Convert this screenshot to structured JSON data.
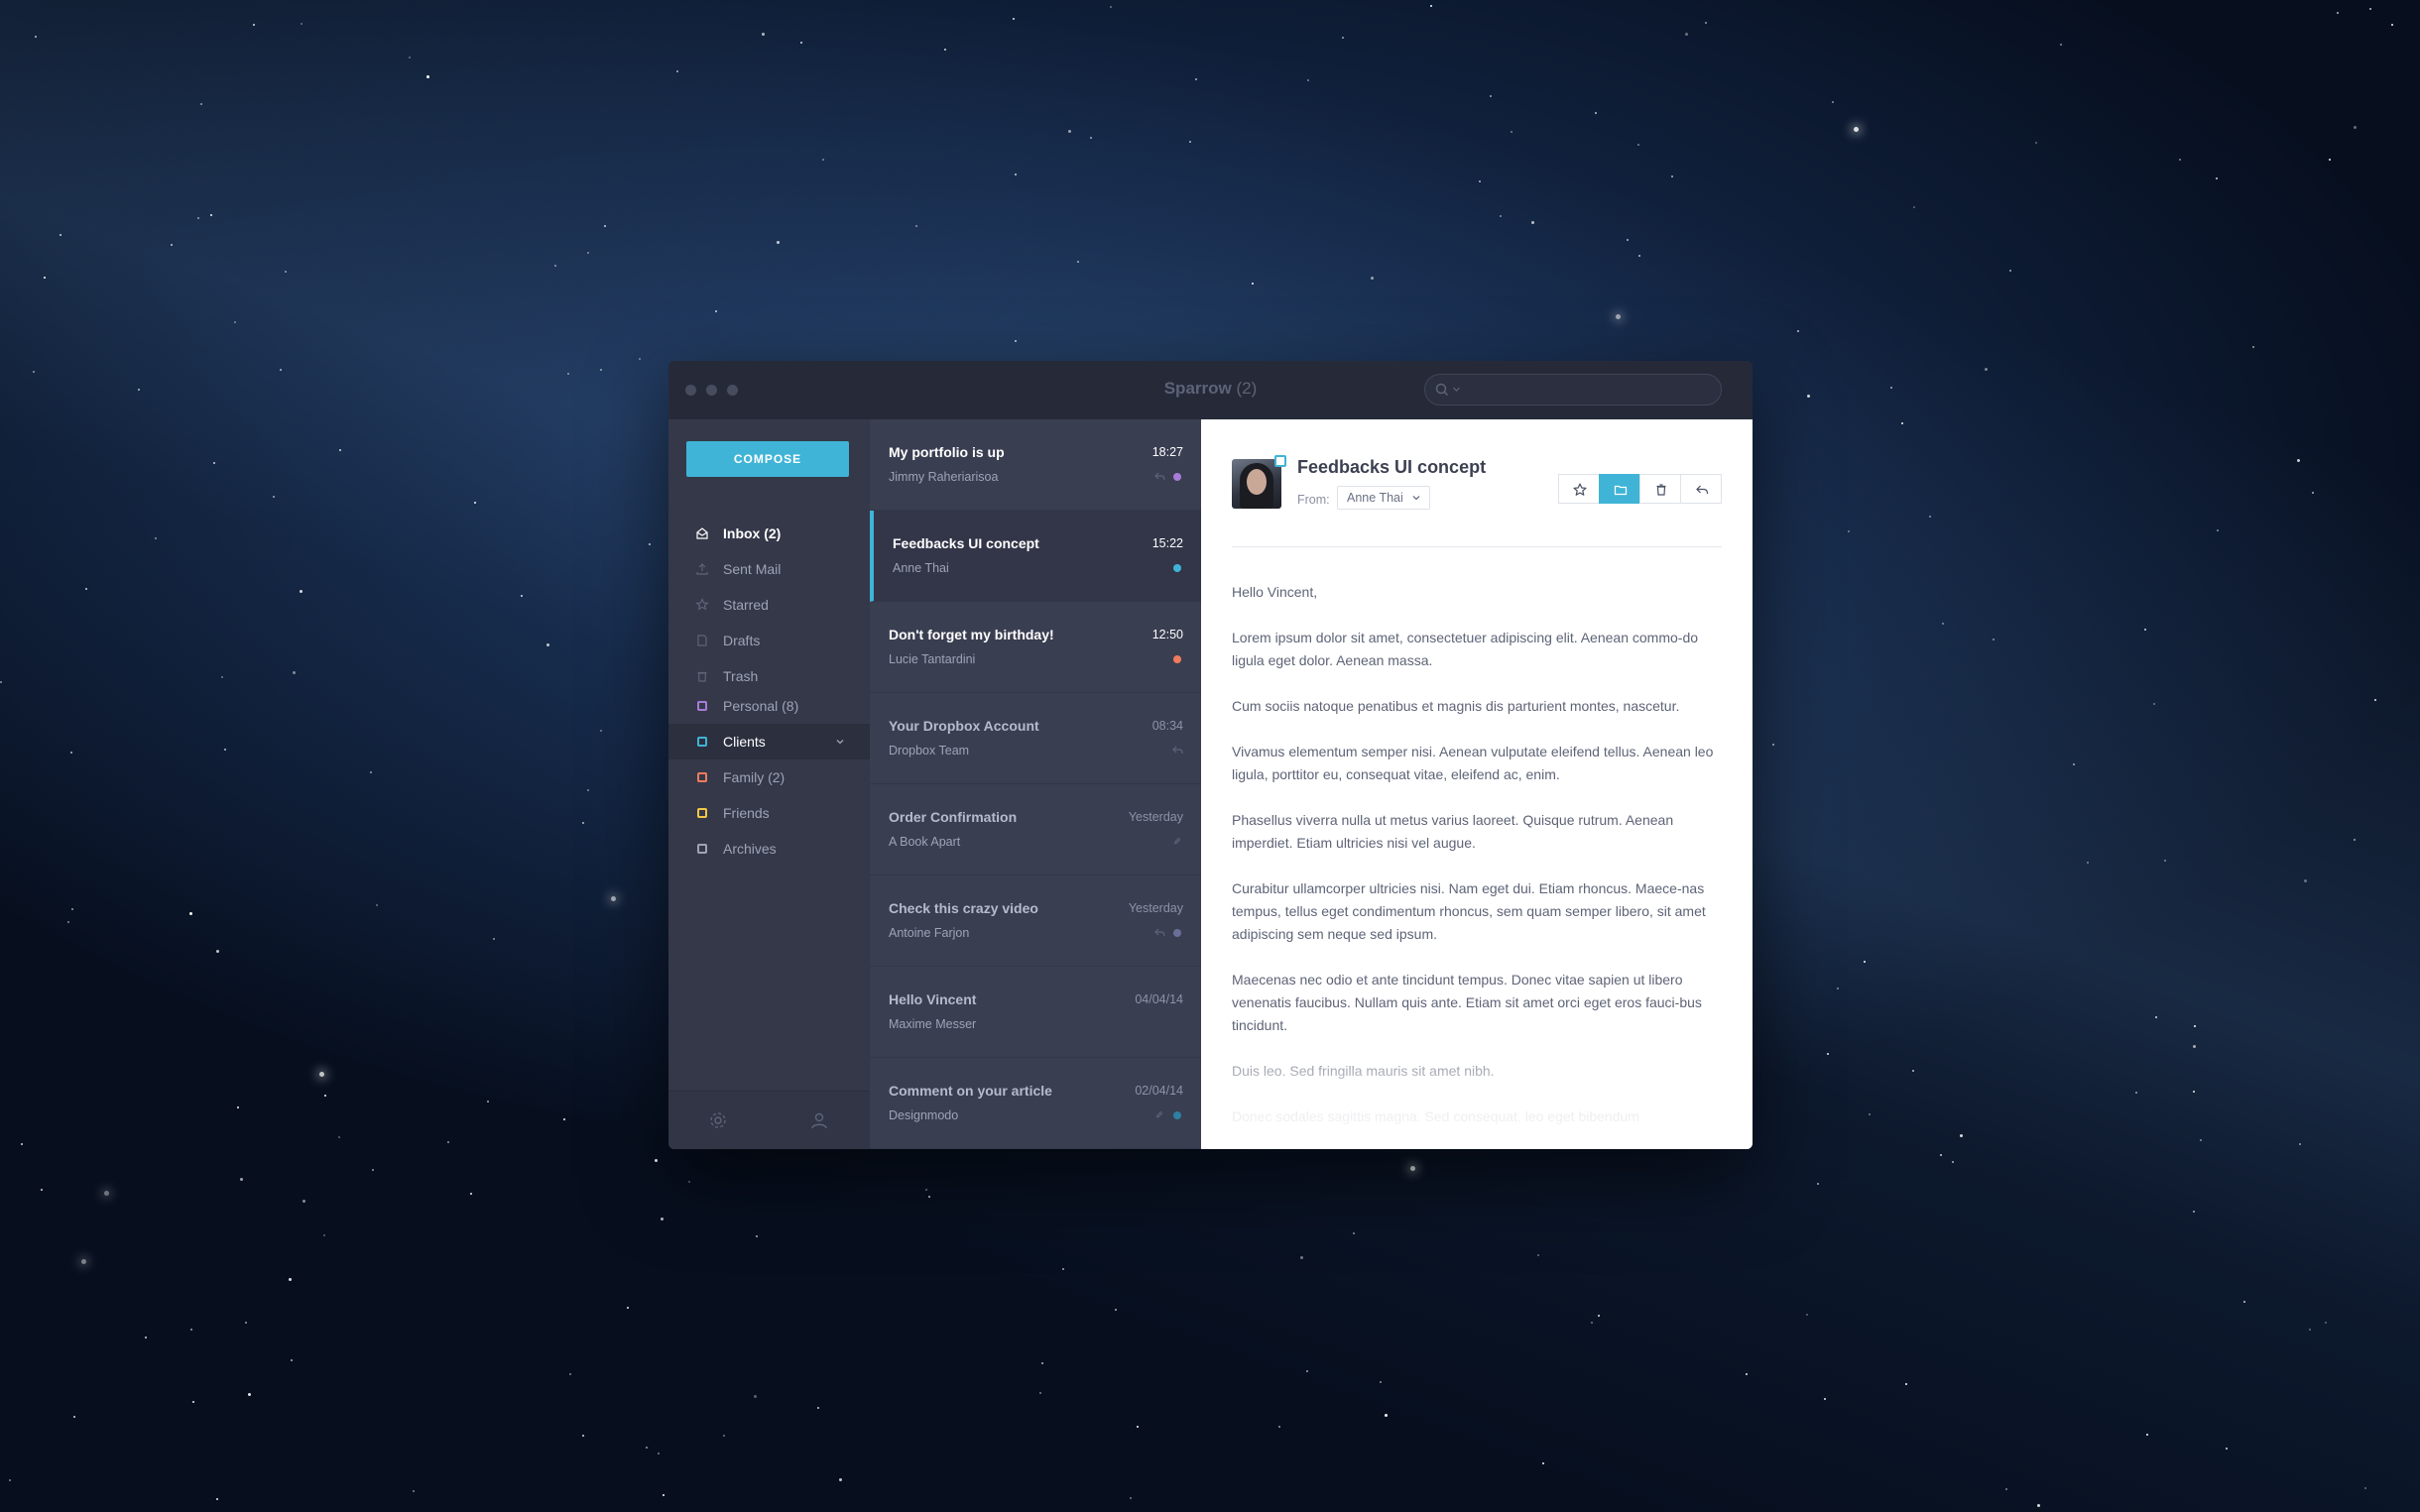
{
  "window": {
    "app_name": "Sparrow",
    "app_count": "(2)"
  },
  "search": {
    "placeholder": ""
  },
  "sidebar": {
    "compose_label": "COMPOSE",
    "mailboxes": [
      {
        "label": "Inbox (2)",
        "icon": "inbox-icon",
        "active": true
      },
      {
        "label": "Sent Mail",
        "icon": "sent-icon"
      },
      {
        "label": "Starred",
        "icon": "star-icon"
      },
      {
        "label": "Drafts",
        "icon": "drafts-icon"
      },
      {
        "label": "Trash",
        "icon": "trash-icon"
      }
    ],
    "folders": [
      {
        "label": "Personal (8)",
        "color": "#a77bd8"
      },
      {
        "label": "Clients",
        "color": "#40b4d6",
        "selected": true
      },
      {
        "label": "Family (2)",
        "color": "#f07b5c"
      },
      {
        "label": "Friends",
        "color": "#f3c647"
      },
      {
        "label": "Archives",
        "color": "#9ea3b6"
      }
    ]
  },
  "messages": [
    {
      "subject": "My portfolio is up",
      "sender": "Jimmy Raheriarisoa",
      "time": "18:27",
      "dot": "#a77bd8",
      "unread": true
    },
    {
      "subject": "Feedbacks UI concept",
      "sender": "Anne Thai",
      "time": "15:22",
      "dot": "#40b4d6",
      "unread": true,
      "active": true
    },
    {
      "subject": "Don't forget my birthday!",
      "sender": "Lucie Tantardini",
      "time": "12:50",
      "dot": "#f07b5c",
      "unread": true
    },
    {
      "subject": "Your Dropbox Account",
      "sender": "Dropbox Team",
      "time": "08:34"
    },
    {
      "subject": "Order Confirmation",
      "sender": "A Book Apart",
      "time": "Yesterday"
    },
    {
      "subject": "Check this crazy video",
      "sender": "Antoine Farjon",
      "time": "Yesterday",
      "dot": "#6a6f9a"
    },
    {
      "subject": "Hello Vincent",
      "sender": "Maxime Messer",
      "time": "04/04/14"
    },
    {
      "subject": "Comment on your article",
      "sender": "Designmodo",
      "time": "02/04/14",
      "dot": "#2e7fa3"
    }
  ],
  "reader": {
    "subject": "Feedbacks UI concept",
    "from_label": "From:",
    "from_value": "Anne Thai",
    "paragraphs": [
      "Hello Vincent,",
      "Lorem ipsum dolor sit amet, consectetuer adipiscing elit. Aenean commo-do ligula eget dolor. Aenean massa.",
      "Cum sociis natoque penatibus et magnis dis parturient montes, nascetur.",
      "Vivamus elementum semper nisi. Aenean vulputate eleifend tellus. Aenean leo ligula, porttitor eu, consequat vitae, eleifend ac, enim.",
      "Phasellus viverra nulla ut metus varius laoreet. Quisque rutrum. Aenean imperdiet. Etiam ultricies nisi vel augue.",
      "Curabitur ullamcorper ultricies nisi. Nam eget dui. Etiam rhoncus. Maece-nas tempus, tellus eget condimentum rhoncus, sem quam semper libero, sit amet adipiscing sem neque sed ipsum.",
      "Maecenas nec odio et ante tincidunt tempus. Donec vitae sapien ut libero venenatis faucibus. Nullam quis ante. Etiam sit amet orci eget eros fauci-bus tincidunt.",
      "Duis leo. Sed fringilla mauris sit amet nibh.",
      "Donec sodales sagittis magna. Sed consequat, leo eget bibendum"
    ]
  },
  "colors": {
    "accent": "#40b4d6"
  }
}
